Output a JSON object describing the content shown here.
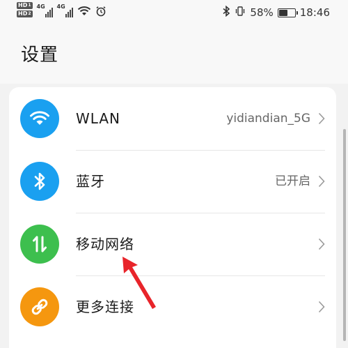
{
  "status_bar": {
    "hd_label": "HD",
    "hd_top_sub": "1",
    "hd_bottom_sub": "2",
    "net1": "4G",
    "net2": "4G",
    "battery_percent": "58%",
    "battery_level": 0.58,
    "time": "18:46",
    "icons": [
      "hd-icon",
      "signal-icon",
      "wifi-icon",
      "alarm-icon",
      "bluetooth-icon",
      "vibrate-icon",
      "battery-icon"
    ]
  },
  "header": {
    "title": "设置"
  },
  "list": {
    "items": [
      {
        "label": "WLAN",
        "value": "yidiandian_5G",
        "icon": "wifi-icon",
        "color": "#1aa0f0"
      },
      {
        "label": "蓝牙",
        "value": "已开启",
        "icon": "bluetooth-icon",
        "color": "#1aa0f0"
      },
      {
        "label": "移动网络",
        "value": "",
        "icon": "mobile-data-icon",
        "color": "#3dbf4e"
      },
      {
        "label": "更多连接",
        "value": "",
        "icon": "link-icon",
        "color": "#f5970f"
      }
    ]
  },
  "annotation": {
    "arrow_color": "#e8242a"
  }
}
